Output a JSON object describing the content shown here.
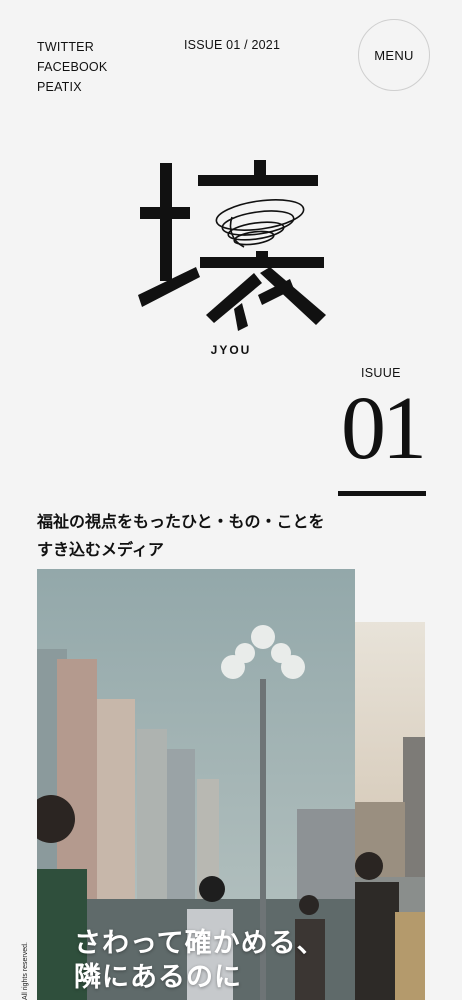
{
  "social": {
    "links": [
      "TWITTER",
      "FACEBOOK",
      "PEATIX"
    ]
  },
  "header": {
    "issue": "ISSUE 01 / 2021",
    "menu_label": "MENU"
  },
  "logo": {
    "kanji": "壌",
    "label": "JYOU"
  },
  "issue_block": {
    "label": "ISUUE",
    "number": "01"
  },
  "tagline": {
    "line1": "福祉の視点をもったひと・もの・ことを",
    "line2": "すき込むメディア"
  },
  "hero": {
    "line1": "さわって確かめる、",
    "line2": "隣にあるのに"
  },
  "footer": {
    "copyright": "All rights reserved."
  }
}
